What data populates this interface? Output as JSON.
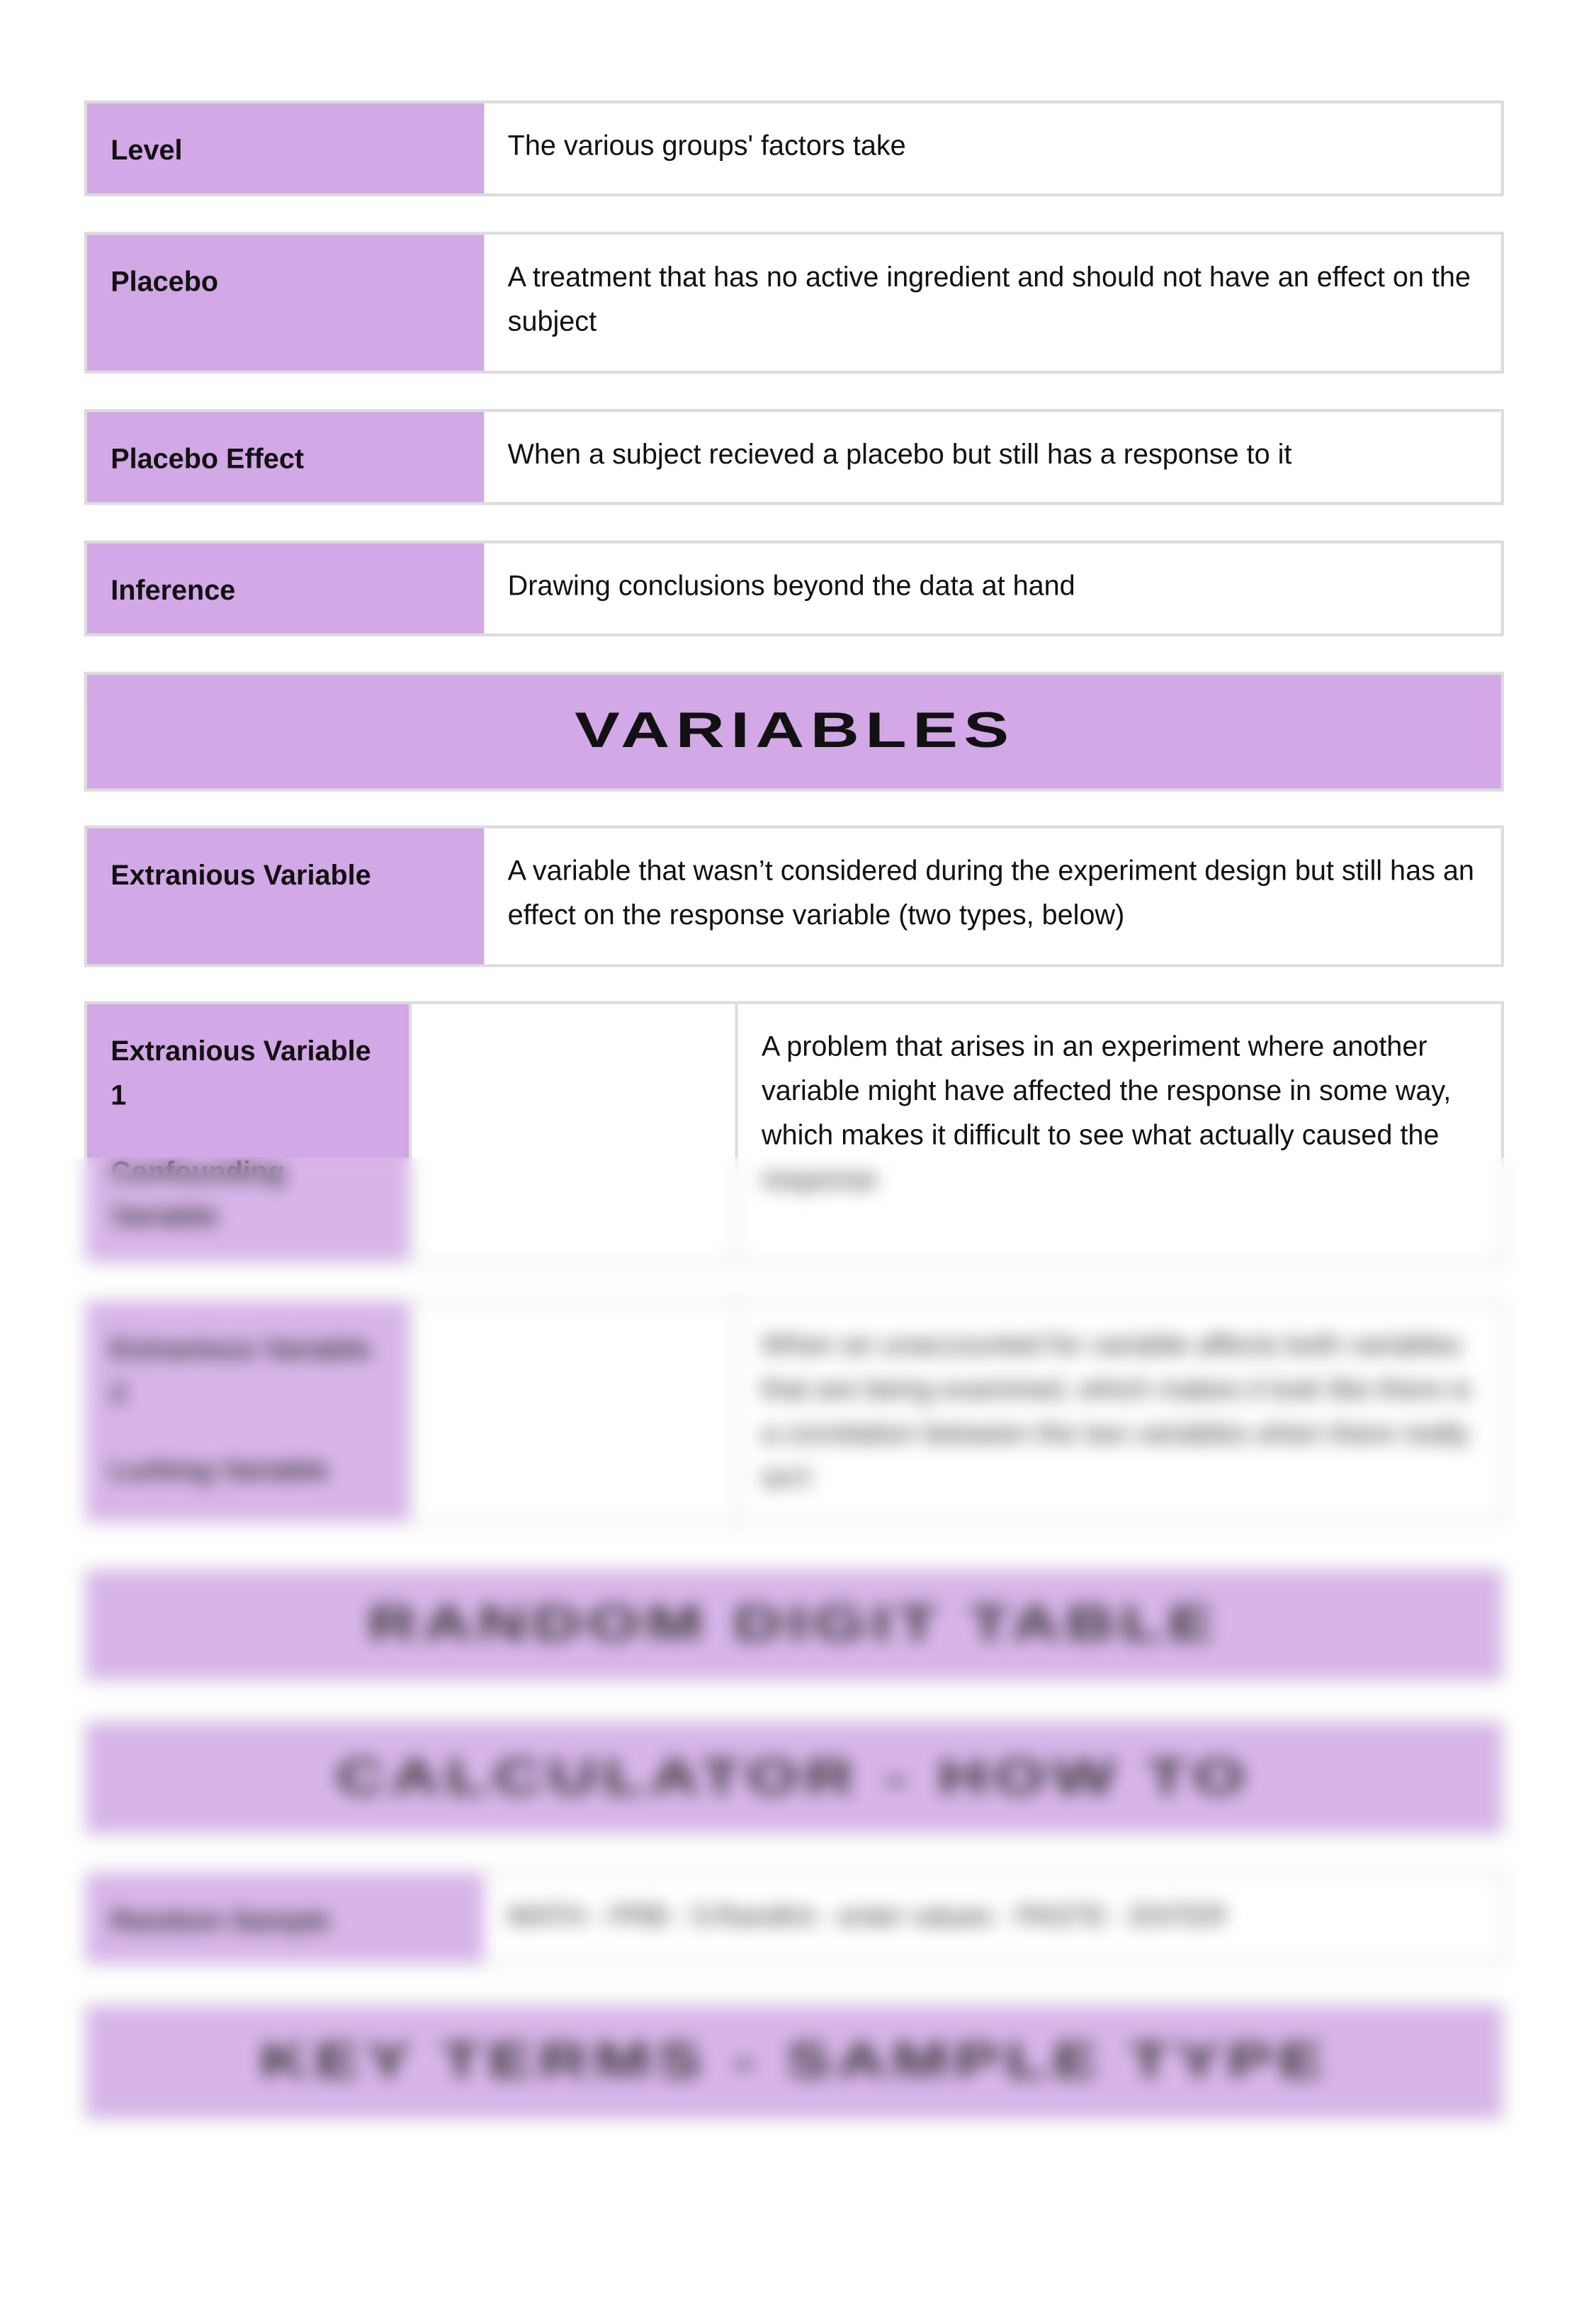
{
  "colors": {
    "accent": "#d2a8e6",
    "border": "#dcdcdc"
  },
  "terms": [
    {
      "term": "Level",
      "definition": "The various groups' factors take"
    },
    {
      "term": "Placebo",
      "definition": "A treatment that has no active ingredient and should not have an effect on the subject"
    },
    {
      "term": "Placebo Effect",
      "definition": "When a subject recieved a placebo but still has a response to it"
    },
    {
      "term": "Inference",
      "definition": "Drawing conclusions beyond the data at hand"
    }
  ],
  "variables": {
    "heading": "VARIABLES",
    "extranious": {
      "term": "Extranious Variable",
      "definition": "A variable that wasn’t considered during the experiment design but still has an effect on the response variable (two types, below)"
    },
    "ev1": {
      "term": "Extranious Variable 1",
      "subterm": "Confounding Variable",
      "definition": "A problem that arises in an experiment where another variable might have affected the response in some way, which makes it difficult to see what actually caused the response"
    },
    "ev2": {
      "term": "Extranious Variable 2",
      "subterm": "Lurking Variable",
      "definition": "When an unaccounted for variable affects both variables that are being examined, which makes it look like there is a correlation between the two variables when there really isn't"
    }
  },
  "random_digit_heading": "RANDOM DIGIT TABLE",
  "calculator": {
    "heading": "CALCULATOR - HOW TO",
    "term": "Random Sample",
    "definition": "MATH - PRB - 5:RandInt - enter values - PASTE - ENTER"
  },
  "key_terms_heading": "KEY TERMS - SAMPLE TYPE"
}
